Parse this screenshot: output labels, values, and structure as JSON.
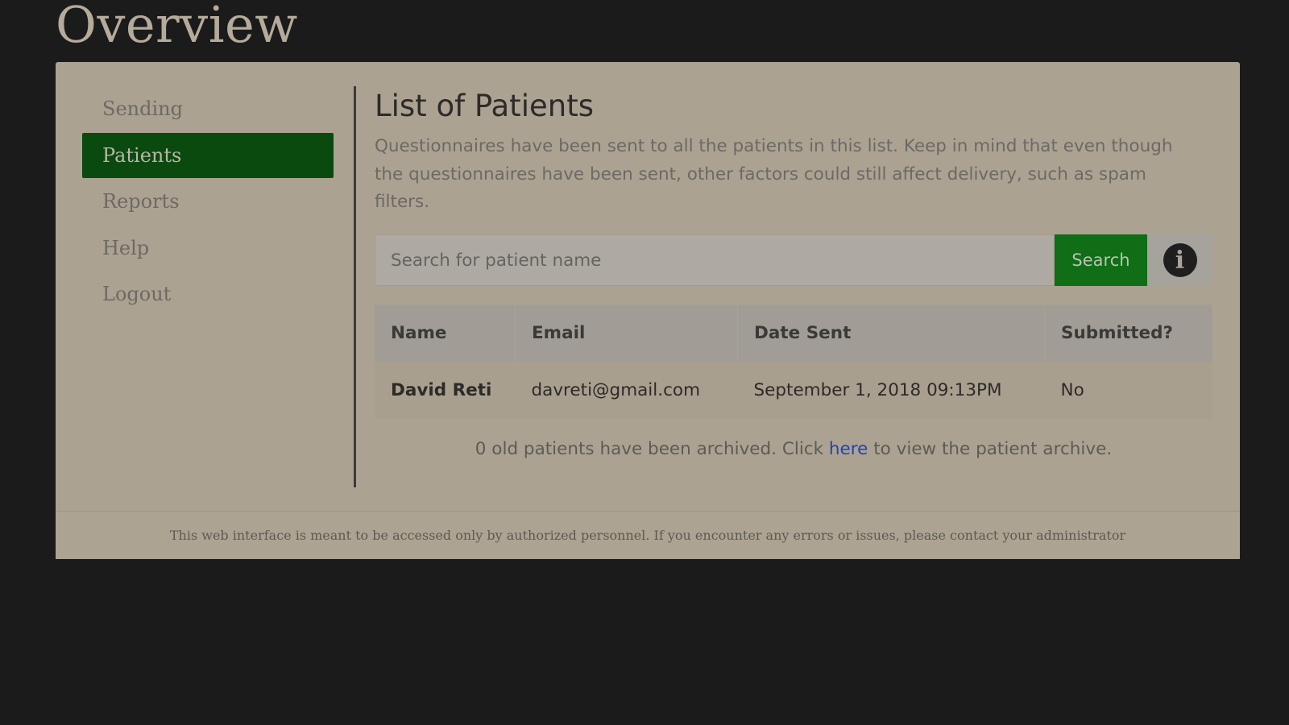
{
  "page": {
    "title": "Overview"
  },
  "sidebar": {
    "items": [
      {
        "label": "Sending",
        "active": false
      },
      {
        "label": "Patients",
        "active": true
      },
      {
        "label": "Reports",
        "active": false
      },
      {
        "label": "Help",
        "active": false
      },
      {
        "label": "Logout",
        "active": false
      }
    ]
  },
  "main": {
    "heading": "List of Patients",
    "description": "Questionnaires have been sent to all the patients in this list. Keep in mind that even though the questionnaires have been sent, other factors could still affect delivery, such as spam filters."
  },
  "search": {
    "placeholder": "Search for patient name",
    "value": "",
    "button_label": "Search",
    "info_icon": "info-circle-icon",
    "info_glyph": "i"
  },
  "table": {
    "headers": [
      "Name",
      "Email",
      "Date Sent",
      "Submitted?"
    ],
    "rows": [
      {
        "name": "David Reti",
        "email": "davreti@gmail.com",
        "date_sent": "September 1, 2018 09:13PM",
        "submitted": "No"
      }
    ]
  },
  "archive": {
    "text_before": "0 old patients have been archived. Click ",
    "link_text": "here",
    "text_after": " to view the patient archive."
  },
  "footer": {
    "text": "This web interface is meant to be accessed only by authorized personnel. If you encounter any errors or issues, please contact your administrator"
  },
  "colors": {
    "accent_green": "#0f6e16",
    "active_nav": "#0b4a0f",
    "link_blue": "#1d46b5",
    "background": "#1b1b1c",
    "panel": "#aca291"
  }
}
